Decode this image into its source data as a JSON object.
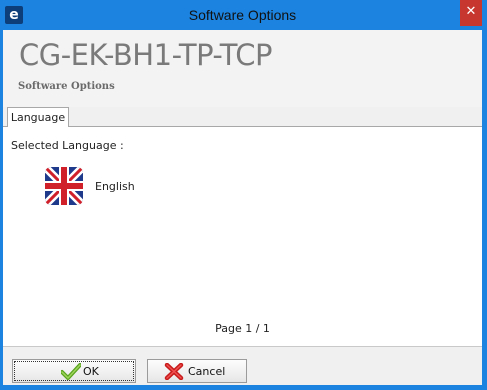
{
  "window": {
    "title": "Software Options",
    "app_icon": "e",
    "close_glyph": "✕",
    "accent_color": "#1c84e0"
  },
  "header": {
    "device_name": "CG-EK-BH1-TP-TCP",
    "subtitle": "Software Options"
  },
  "tabs": [
    {
      "label": "Language",
      "active": true
    }
  ],
  "language_panel": {
    "selected_label": "Selected Language :",
    "languages": [
      {
        "name": "English",
        "icon": "uk-flag-icon"
      }
    ],
    "page_info": "Page 1 / 1"
  },
  "buttons": {
    "ok": {
      "label": "OK",
      "icon": "check-icon"
    },
    "cancel": {
      "label": "Cancel",
      "icon": "x-icon"
    }
  }
}
